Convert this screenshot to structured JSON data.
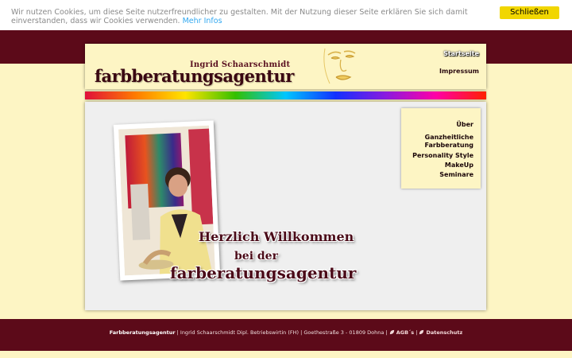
{
  "cookie_notice": {
    "text": "Wir nutzen Cookies, um diese Seite nutzerfreundlicher zu gestalten. Mit der Nutzung dieser Seite erklären Sie sich damit einverstanden, dass wir Cookies verwenden.",
    "more_link": "Mehr Infos",
    "close_button": "Schließen",
    "button_color": "#f1d600"
  },
  "header": {
    "owner_name": "Ingrid Schaarschmidt",
    "logo_text": "farbberatungsagentur",
    "nav": {
      "home": "Startseite",
      "impressum": "Impressum"
    }
  },
  "side_menu": {
    "items": [
      {
        "label": "Über"
      },
      {
        "label": "Ganzheitliche Farbberatung"
      },
      {
        "label": "Personality Style"
      },
      {
        "label": "MakeUp"
      },
      {
        "label": "Seminare"
      }
    ]
  },
  "welcome": {
    "line1": "Herzlich Willkommen",
    "line2": "bei der",
    "line3": "farberatungsagentur"
  },
  "footer": {
    "company": "Farbberatungsagentur",
    "details": " | Ingrid Schaarschmidt Dipl. Betriebswirtin (FH) | Goethestraße 3 - 01809 Dohna | ",
    "agb_link": "AGB´s",
    "separator": " | ",
    "privacy_link": "Datenschutz"
  },
  "colors": {
    "brand_dark": "#5c0a19",
    "cream": "#fdf5c4",
    "content_grey": "#efefef"
  },
  "icons": {
    "footer_link_icon": "leaf-icon",
    "header_art": "face-sketch-icon"
  }
}
